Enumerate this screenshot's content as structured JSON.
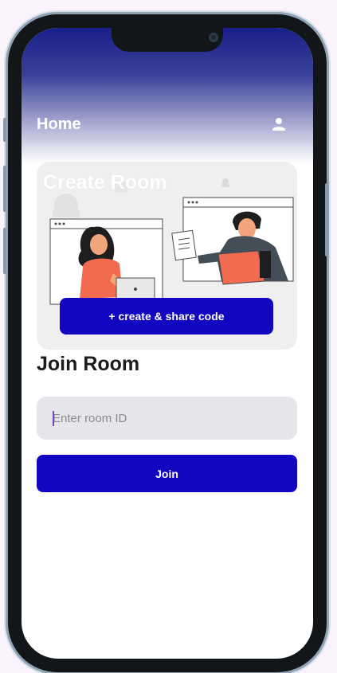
{
  "app_bar": {
    "title": "Home",
    "profile_icon": "person-icon"
  },
  "create_room": {
    "title": "Create Room",
    "button_label": "+ create & share code",
    "illustration": "people-collaborating-illustration"
  },
  "join_room": {
    "title": "Join Room",
    "input_placeholder": "Enter room ID",
    "input_value": "",
    "button_label": "Join"
  },
  "colors": {
    "primary": "#1306c0",
    "header_gradient_top": "#1a1f8a",
    "input_background": "#e5e5ea",
    "card_background": "#efefef"
  }
}
